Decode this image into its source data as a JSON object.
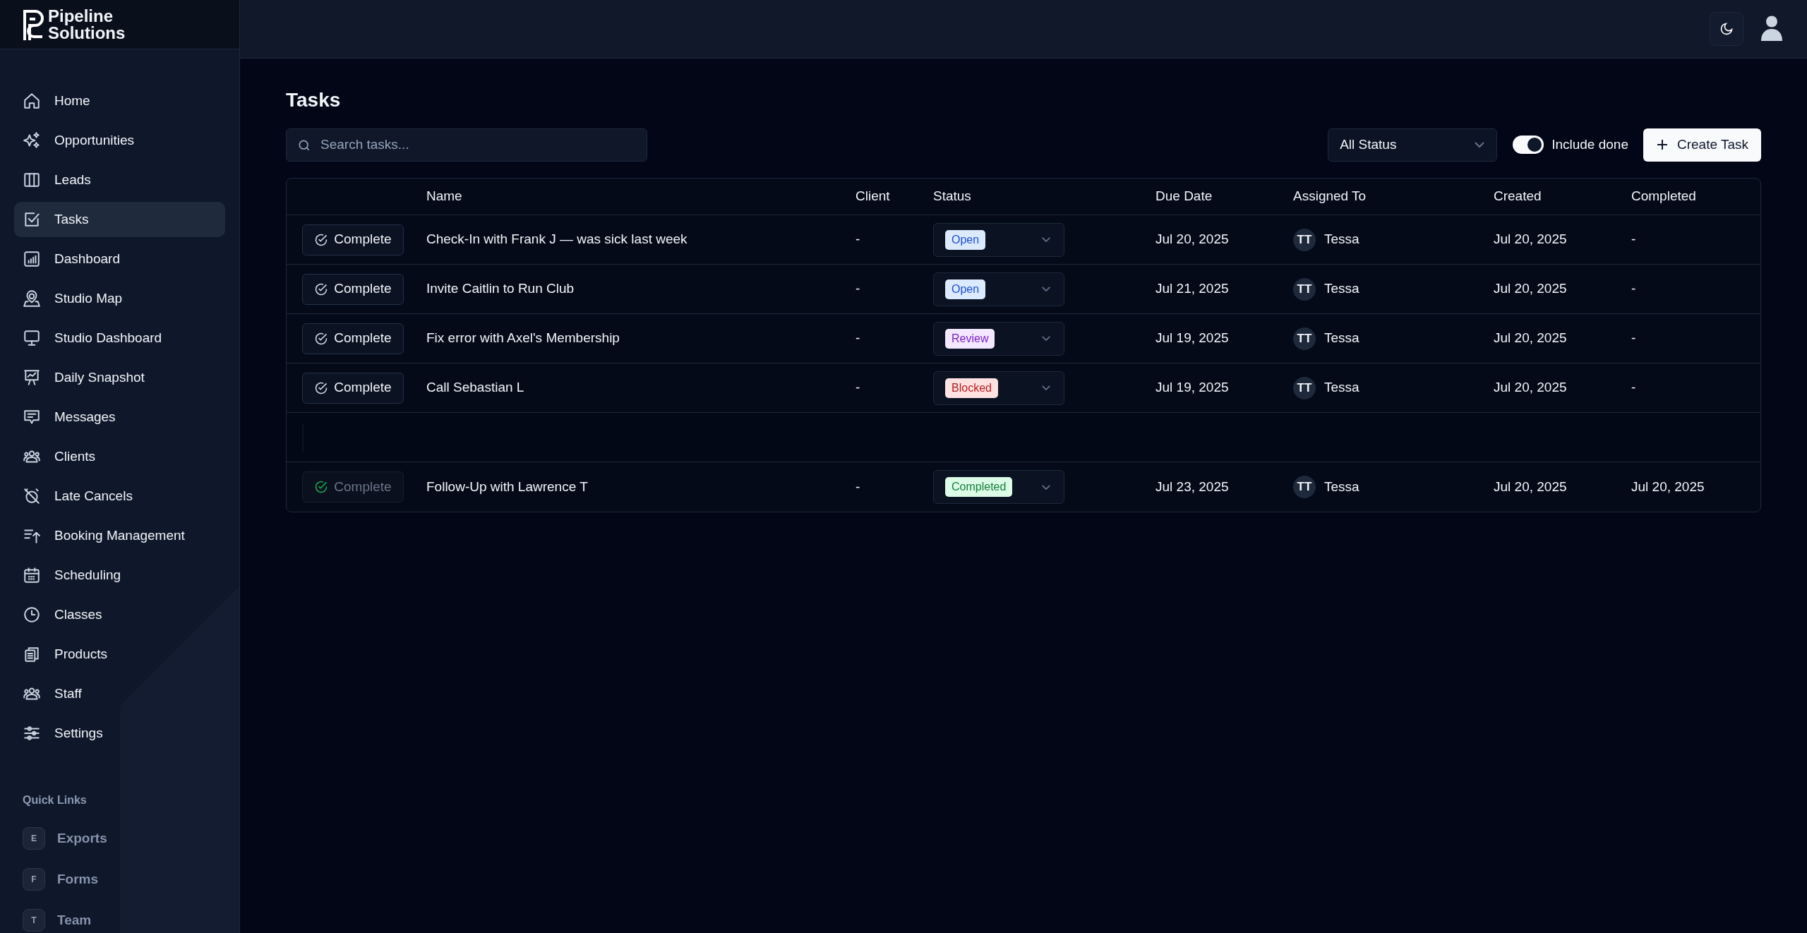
{
  "brand": {
    "line_1": "Pipeline",
    "line_2": "Solutions"
  },
  "sidebar": {
    "items": [
      {
        "label": "Home",
        "selected": false
      },
      {
        "label": "Opportunities",
        "selected": false
      },
      {
        "label": "Leads",
        "selected": false
      },
      {
        "label": "Tasks",
        "selected": true
      },
      {
        "label": "Dashboard",
        "selected": false
      },
      {
        "label": "Studio Map",
        "selected": false
      },
      {
        "label": "Studio Dashboard",
        "selected": false
      },
      {
        "label": "Daily Snapshot",
        "selected": false
      },
      {
        "label": "Messages",
        "selected": false
      },
      {
        "label": "Clients",
        "selected": false
      },
      {
        "label": "Late Cancels",
        "selected": false
      },
      {
        "label": "Booking Management",
        "selected": false
      },
      {
        "label": "Scheduling",
        "selected": false
      },
      {
        "label": "Classes",
        "selected": false
      },
      {
        "label": "Products",
        "selected": false
      },
      {
        "label": "Staff",
        "selected": false
      },
      {
        "label": "Settings",
        "selected": false
      }
    ],
    "quick_links_title": "Quick Links",
    "quick_links": [
      {
        "letter": "E",
        "label": "Exports"
      },
      {
        "letter": "F",
        "label": "Forms"
      },
      {
        "letter": "T",
        "label": "Team"
      }
    ]
  },
  "page": {
    "title": "Tasks",
    "search": {
      "placeholder": "Search tasks..."
    },
    "status_filter": "All Status",
    "include_done": {
      "label": "Include done",
      "on": true
    },
    "create_button": "Create Task"
  },
  "table": {
    "columns": [
      "Name",
      "Client",
      "Status",
      "Due Date",
      "Assigned To",
      "Created",
      "Completed"
    ],
    "rows": [
      {
        "kind": "task",
        "action": "Complete",
        "done": false,
        "name": "Check-In with Frank J — was sick last week",
        "client": "-",
        "status": {
          "label": "Open",
          "kind": "open"
        },
        "due": "Jul 20, 2025",
        "initials": "TT",
        "assignee": "Tessa",
        "created": "Jul 20, 2025",
        "completed": "-"
      },
      {
        "kind": "task",
        "action": "Complete",
        "done": false,
        "name": "Invite Caitlin to Run Club",
        "client": "-",
        "status": {
          "label": "Open",
          "kind": "open"
        },
        "due": "Jul 21, 2025",
        "initials": "TT",
        "assignee": "Tessa",
        "created": "Jul 20, 2025",
        "completed": "-"
      },
      {
        "kind": "task",
        "action": "Complete",
        "done": false,
        "name": "Fix error with Axel's Membership",
        "client": "-",
        "status": {
          "label": "Review",
          "kind": "review"
        },
        "due": "Jul 19, 2025",
        "initials": "TT",
        "assignee": "Tessa",
        "created": "Jul 20, 2025",
        "completed": "-"
      },
      {
        "kind": "task",
        "action": "Complete",
        "done": false,
        "name": "Call Sebastian L",
        "client": "-",
        "status": {
          "label": "Blocked",
          "kind": "blocked"
        },
        "due": "Jul 19, 2025",
        "initials": "TT",
        "assignee": "Tessa",
        "created": "Jul 20, 2025",
        "completed": "-"
      },
      {
        "kind": "blank"
      },
      {
        "kind": "task",
        "action": "Complete",
        "done": true,
        "name": "Follow-Up with Lawrence T",
        "client": "-",
        "status": {
          "label": "Completed",
          "kind": "completed"
        },
        "due": "Jul 23, 2025",
        "initials": "TT",
        "assignee": "Tessa",
        "created": "Jul 20, 2025",
        "completed": "Jul 20, 2025"
      }
    ]
  }
}
